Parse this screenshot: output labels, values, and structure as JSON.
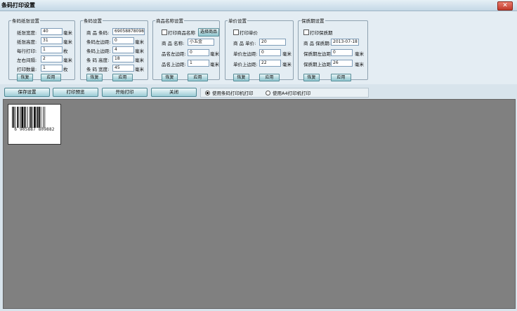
{
  "window": {
    "title": "条码打印设置",
    "close_glyph": "✕"
  },
  "paper": {
    "legend": "条码纸张设置",
    "rows": [
      {
        "label": "纸张宽度:",
        "value": "40",
        "unit": "毫米"
      },
      {
        "label": "纸张高度:",
        "value": "31",
        "unit": "毫米"
      },
      {
        "label": "每行打印:",
        "value": "1",
        "unit": "枚"
      },
      {
        "label": "左右间隔:",
        "value": "2",
        "unit": "毫米"
      },
      {
        "label": "打印数量:",
        "value": "1",
        "unit": "枚"
      }
    ],
    "restore": "恢复",
    "apply": "应用"
  },
  "barcode": {
    "legend": "条码设置",
    "rows": [
      {
        "label": "商 品 条码:",
        "value": "6905887809882",
        "unit": ""
      },
      {
        "label": "条码左边距:",
        "value": "0",
        "unit": "毫米"
      },
      {
        "label": "条码上边距:",
        "value": "4",
        "unit": "毫米"
      },
      {
        "label": "条 码 高度:",
        "value": "18",
        "unit": "毫米"
      },
      {
        "label": "条 码 宽度:",
        "value": "45",
        "unit": "毫米"
      }
    ],
    "restore": "恢复",
    "apply": "应用"
  },
  "name": {
    "legend": "商品名称设置",
    "checkbox": "打印商品名称",
    "checked": false,
    "select": "选择商品",
    "rows": [
      {
        "label": "商 品 名称:",
        "value": "小五金",
        "unit": ""
      },
      {
        "label": "品名左边距:",
        "value": "0",
        "unit": "毫米"
      },
      {
        "label": "品名上边距:",
        "value": "1",
        "unit": "毫米"
      }
    ],
    "restore": "恢复",
    "apply": "应用"
  },
  "price": {
    "legend": "单价设置",
    "checkbox": "打印单价",
    "checked": false,
    "rows": [
      {
        "label": "商 品 单价:",
        "value": "20",
        "unit": ""
      },
      {
        "label": "单价左边距:",
        "value": "0",
        "unit": "毫米"
      },
      {
        "label": "单价上边距:",
        "value": "22",
        "unit": "毫米"
      }
    ],
    "restore": "恢复",
    "apply": "应用"
  },
  "expiry": {
    "legend": "保质期设置",
    "checkbox": "打印保质期",
    "checked": false,
    "rows": [
      {
        "label": "商 品 保质期:",
        "value": "2013-07-18",
        "unit": ""
      },
      {
        "label": "保质期左边距:",
        "value": "0",
        "unit": "毫米"
      },
      {
        "label": "保质期上边距:",
        "value": "26",
        "unit": "毫米"
      }
    ],
    "restore": "恢复",
    "apply": "应用"
  },
  "toolbar": {
    "save": "保存设置",
    "preview": "打印预览",
    "print": "开始打印",
    "close": "关闭",
    "radio_barcode": "使用条码打印机打印",
    "radio_a4": "使用A4打印机打印",
    "selected_printer": "barcode"
  },
  "preview": {
    "barcode_number": "6 905887 809882"
  }
}
